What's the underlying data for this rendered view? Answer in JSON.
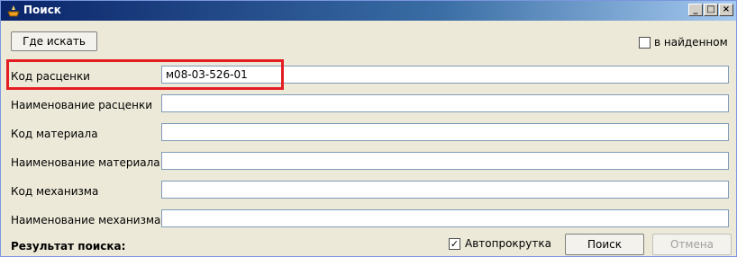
{
  "window": {
    "title": "Поиск",
    "minimize_glyph": "_",
    "maximize_glyph": "□",
    "close_glyph": "×"
  },
  "toolbar": {
    "where_to_search_label": "Где искать",
    "in_found_checked": false,
    "in_found_label": "в найденном"
  },
  "fields": [
    {
      "label": "Код расценки",
      "value": "м08-03-526-01"
    },
    {
      "label": "Наименование расценки",
      "value": ""
    },
    {
      "label": "Код материала",
      "value": ""
    },
    {
      "label": "Наименование материала",
      "value": ""
    },
    {
      "label": "Код механизма",
      "value": ""
    },
    {
      "label": "Наименование механизма",
      "value": ""
    }
  ],
  "footer": {
    "result_label": "Результат поиска:",
    "autoscroll_checked": true,
    "autoscroll_label": "Автопрокрутка",
    "search_button": "Поиск",
    "cancel_button": "Отмена"
  },
  "icons": {
    "title_icon": "search-app-icon",
    "check_mark": "✓"
  }
}
